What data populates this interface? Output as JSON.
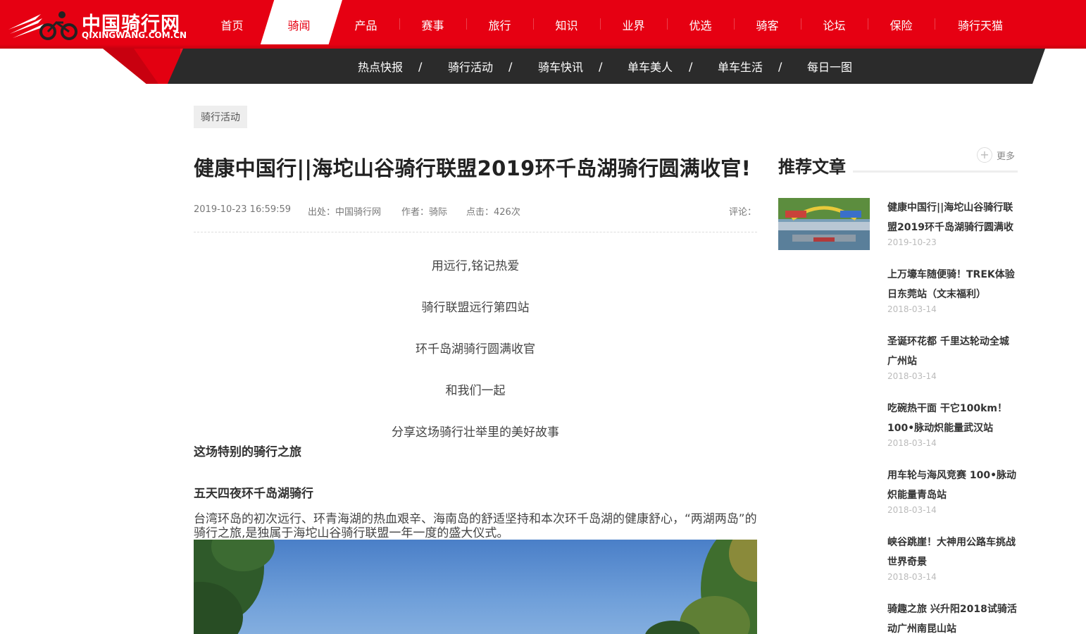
{
  "header": {
    "logo_cn": "中国骑行网",
    "logo_en": "QIXINGWANG.COM.CN",
    "nav": [
      "首页",
      "骑闻",
      "产品",
      "赛事",
      "旅行",
      "知识",
      "业界",
      "优选",
      "骑客",
      "论坛",
      "保险",
      "骑行天猫"
    ],
    "active_nav": "骑闻",
    "subnav": [
      "热点快报",
      "骑行活动",
      "骑车快讯",
      "单车美人",
      "单车生活",
      "每日一图"
    ],
    "subnav_separator": "/"
  },
  "article": {
    "category": "骑行活动",
    "title": "健康中国行||海坨山谷骑行联盟2019环千岛湖骑行圆满收官!",
    "meta": {
      "datetime": "2019-10-23 16:59:59",
      "source": "出处：中国骑行网",
      "author": "作者：骑际",
      "clicks": "点击：426次",
      "comments": "评论："
    },
    "intro_lines": [
      "用远行,铭记热爱",
      "骑行联盟远行第四站",
      "环千岛湖骑行圆满收官",
      "和我们一起",
      "分享这场骑行壮举里的美好故事"
    ],
    "heading1": "这场特别的骑行之旅",
    "heading2": "五天四夜环千岛湖骑行",
    "paragraph": "台湾环岛的初次远行、环青海湖的热血艰辛、海南岛的舒适坚持和本次环千岛湖的健康舒心，“两湖两岛”的骑行之旅,是独属于海坨山谷骑行联盟一年一度的盛大仪式。"
  },
  "sidebar": {
    "title": "推荐文章",
    "more": "更多",
    "items": [
      {
        "title": "健康中国行||海坨山谷骑行联盟2019环千岛湖骑行圆满收",
        "date": "2019-10-23"
      },
      {
        "title": "上万壕车随便骑！TREK体验日东莞站（文末福利）",
        "date": "2018-03-14"
      },
      {
        "title": "圣诞环花都 千里达轮动全城广州站",
        "date": "2018-03-14"
      },
      {
        "title": "吃碗热干面 干它100km！100•脉动炽能量武汉站",
        "date": "2018-03-14"
      },
      {
        "title": "用车轮与海风竞赛 100•脉动炽能量青岛站",
        "date": "2018-03-14"
      },
      {
        "title": "峡谷跳崖！大神用公路车挑战世界奇景",
        "date": "2018-03-14"
      },
      {
        "title": "骑趣之旅 兴升阳2018试骑活动广州南昆山站",
        "date": ""
      }
    ]
  },
  "colors": {
    "brand_red": "#e60012",
    "subnav_dark": "#2b2b2b"
  }
}
